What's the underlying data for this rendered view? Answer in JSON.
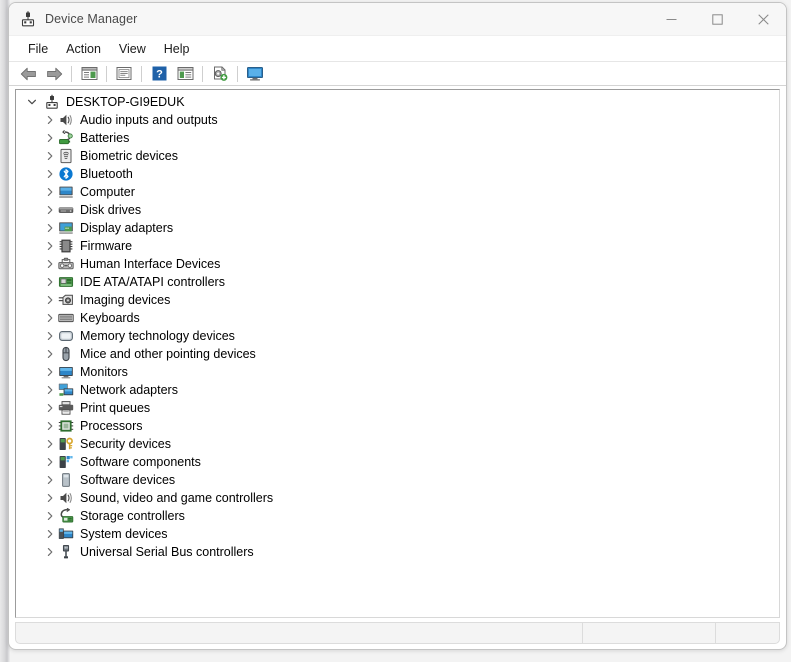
{
  "window": {
    "title": "Device Manager",
    "title_icon": "device-manager-icon",
    "controls": {
      "minimize": "minimize-icon",
      "maximize": "maximize-icon",
      "close": "close-icon"
    }
  },
  "menubar": {
    "items": [
      {
        "label": "File"
      },
      {
        "label": "Action"
      },
      {
        "label": "View"
      },
      {
        "label": "Help"
      }
    ]
  },
  "toolbar": {
    "buttons": [
      {
        "name": "back-arrow-icon",
        "tooltip": "Back"
      },
      {
        "name": "forward-arrow-icon",
        "tooltip": "Forward"
      },
      {
        "name": "separator-1",
        "tooltip": ""
      },
      {
        "name": "show-hide-console-tree-icon",
        "tooltip": "Show/Hide Console Tree"
      },
      {
        "name": "separator-2",
        "tooltip": ""
      },
      {
        "name": "properties-icon",
        "tooltip": "Properties"
      },
      {
        "name": "separator-3",
        "tooltip": ""
      },
      {
        "name": "help-icon",
        "tooltip": "Help"
      },
      {
        "name": "update-driver-icon",
        "tooltip": "Update Driver Software"
      },
      {
        "name": "separator-4",
        "tooltip": ""
      },
      {
        "name": "scan-for-hardware-changes-icon",
        "tooltip": "Scan for hardware changes"
      },
      {
        "name": "separator-5",
        "tooltip": ""
      },
      {
        "name": "display-device-icon",
        "tooltip": "Display devices"
      }
    ]
  },
  "tree": {
    "root": {
      "label": "DESKTOP-GI9EDUK",
      "icon": "computer-node-icon",
      "expanded": true
    },
    "items": [
      {
        "label": "Audio inputs and outputs",
        "icon": "speaker-icon",
        "expanded": false
      },
      {
        "label": "Batteries",
        "icon": "battery-icon",
        "expanded": false
      },
      {
        "label": "Biometric devices",
        "icon": "biometric-icon",
        "expanded": false
      },
      {
        "label": "Bluetooth",
        "icon": "bluetooth-icon",
        "expanded": false
      },
      {
        "label": "Computer",
        "icon": "computer-icon",
        "expanded": false
      },
      {
        "label": "Disk drives",
        "icon": "disk-drive-icon",
        "expanded": false
      },
      {
        "label": "Display adapters",
        "icon": "display-adapter-icon",
        "expanded": false
      },
      {
        "label": "Firmware",
        "icon": "firmware-icon",
        "expanded": false
      },
      {
        "label": "Human Interface Devices",
        "icon": "hid-icon",
        "expanded": false
      },
      {
        "label": "IDE ATA/ATAPI controllers",
        "icon": "ide-controller-icon",
        "expanded": false
      },
      {
        "label": "Imaging devices",
        "icon": "imaging-device-icon",
        "expanded": false
      },
      {
        "label": "Keyboards",
        "icon": "keyboard-icon",
        "expanded": false
      },
      {
        "label": "Memory technology devices",
        "icon": "memory-device-icon",
        "expanded": false
      },
      {
        "label": "Mice and other pointing devices",
        "icon": "mouse-icon",
        "expanded": false
      },
      {
        "label": "Monitors",
        "icon": "monitor-icon",
        "expanded": false
      },
      {
        "label": "Network adapters",
        "icon": "network-adapter-icon",
        "expanded": false
      },
      {
        "label": "Print queues",
        "icon": "printer-icon",
        "expanded": false
      },
      {
        "label": "Processors",
        "icon": "processor-icon",
        "expanded": false
      },
      {
        "label": "Security devices",
        "icon": "security-device-icon",
        "expanded": false
      },
      {
        "label": "Software components",
        "icon": "software-component-icon",
        "expanded": false
      },
      {
        "label": "Software devices",
        "icon": "software-device-icon",
        "expanded": false
      },
      {
        "label": "Sound, video and game controllers",
        "icon": "sound-controller-icon",
        "expanded": false
      },
      {
        "label": "Storage controllers",
        "icon": "storage-controller-icon",
        "expanded": false
      },
      {
        "label": "System devices",
        "icon": "system-device-icon",
        "expanded": false
      },
      {
        "label": "Universal Serial Bus controllers",
        "icon": "usb-controller-icon",
        "expanded": false
      }
    ]
  },
  "statusbar": {
    "segments": [
      "",
      "",
      ""
    ]
  },
  "colors": {
    "window_bg": "#ffffff",
    "titlebar_bg": "#f7f7f7",
    "statusbar_bg": "#f4f4f4",
    "text": "#000000",
    "title_text": "#4a4a4a",
    "chevron": "#6d6d6d",
    "bluetooth_blue": "#0a78d1",
    "accent_green": "#3f9a3f"
  }
}
